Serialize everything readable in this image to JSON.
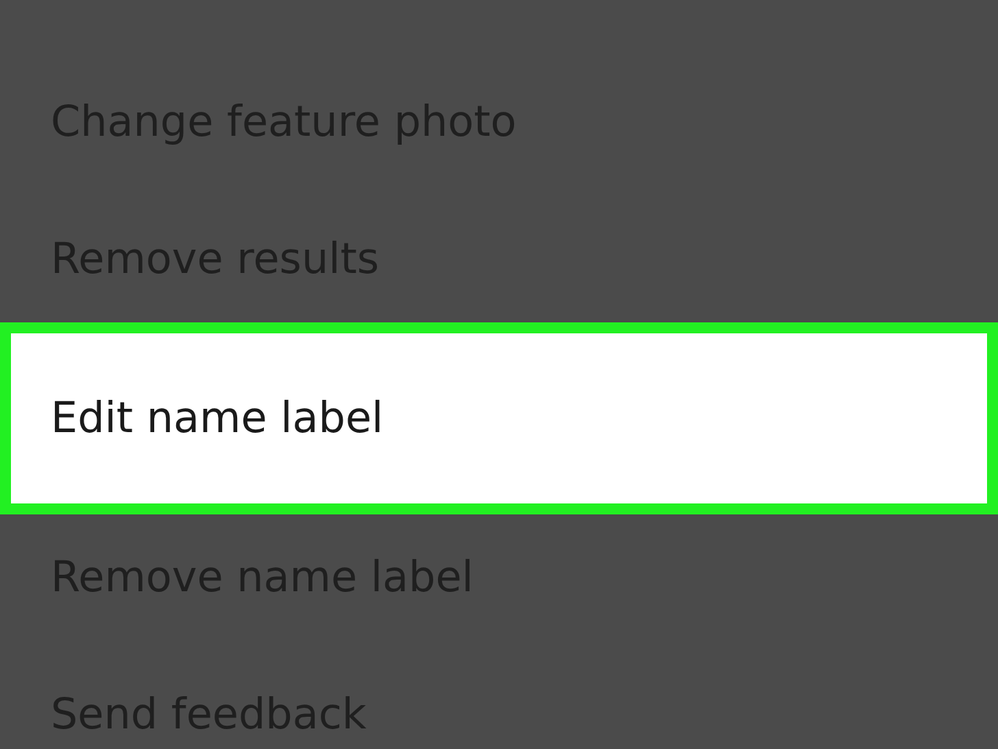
{
  "menu": {
    "items": [
      {
        "label": "Change feature photo",
        "selected": false
      },
      {
        "label": "Remove results",
        "selected": false
      },
      {
        "label": "Edit name label",
        "selected": true
      },
      {
        "label": "Remove name label",
        "selected": false
      },
      {
        "label": "Send feedback",
        "selected": false
      }
    ]
  }
}
